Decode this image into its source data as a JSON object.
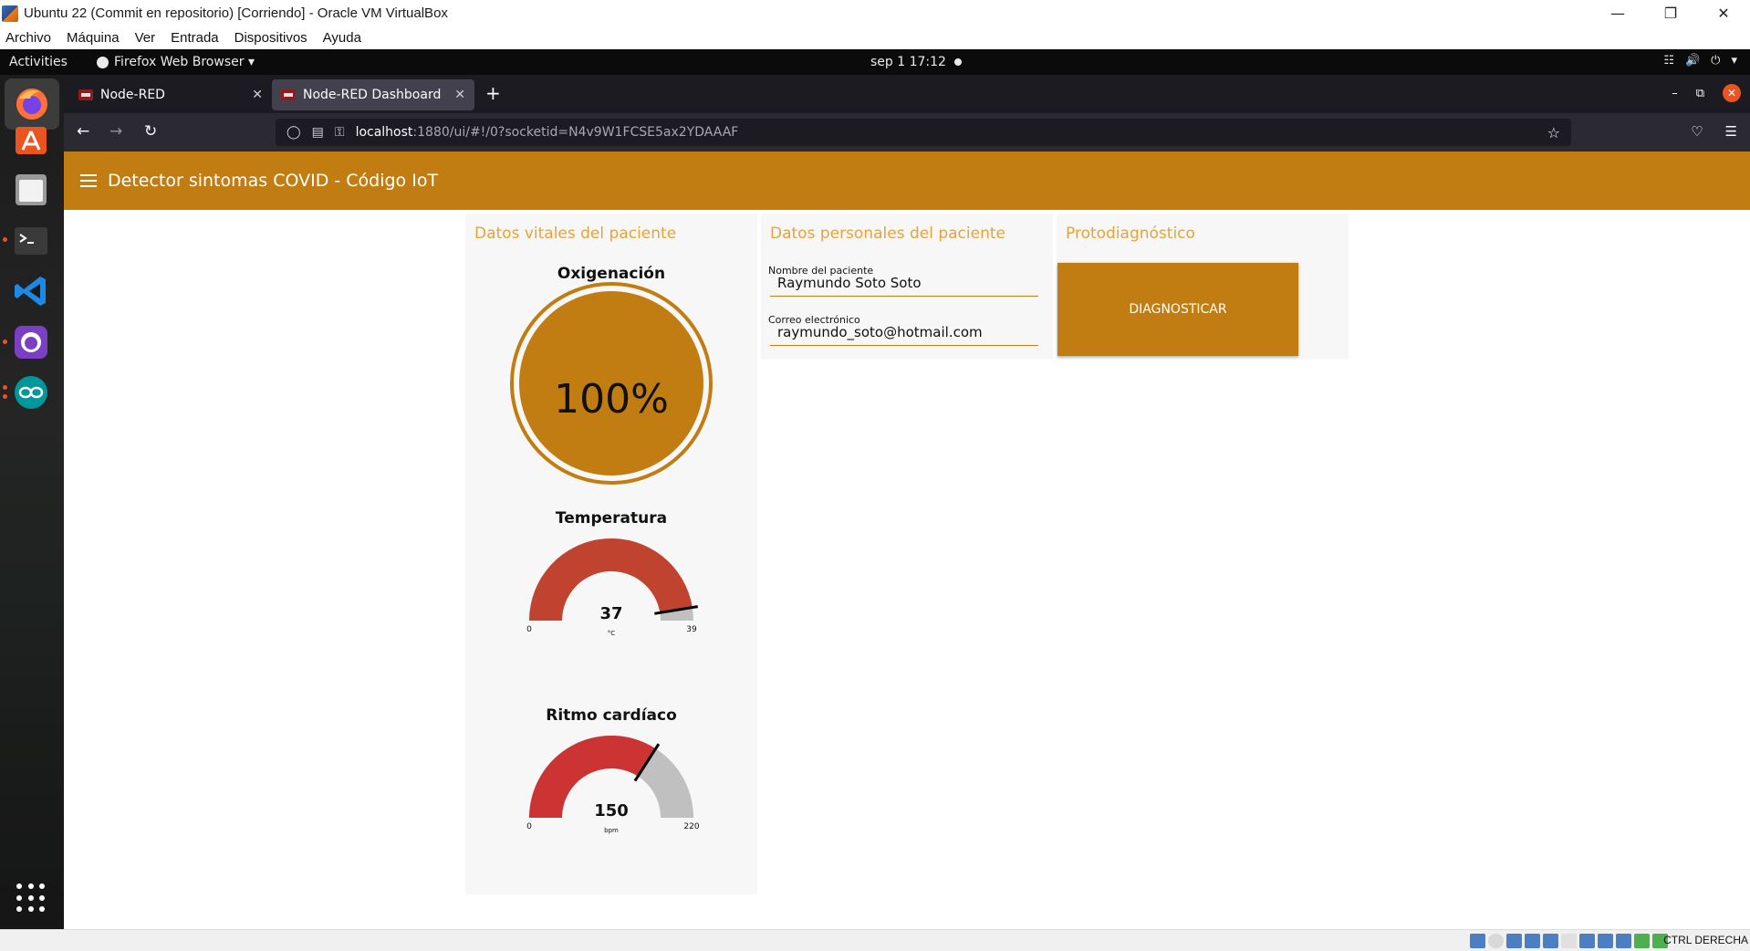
{
  "window": {
    "title": "Ubuntu 22 (Commit en repositorio) [Corriendo] - Oracle VM VirtualBox",
    "controls": {
      "minimize": "—",
      "restore": "❐",
      "close": "✕"
    },
    "menus": [
      "Archivo",
      "Máquina",
      "Ver",
      "Entrada",
      "Dispositivos",
      "Ayuda"
    ]
  },
  "gnome": {
    "activities": "Activities",
    "app_name": "Firefox Web Browser ▾",
    "clock": "sep 1  17:12"
  },
  "firefox": {
    "tabs": [
      {
        "label": "Node-RED",
        "close": "✕"
      },
      {
        "label": "Node-RED Dashboard",
        "close": "✕"
      }
    ],
    "new_tab": "+",
    "url_host": "localhost",
    "url_path": ":1880/ui/#!/0?socketid=N4v9W1FCSE5ax2YDAAAF"
  },
  "dashboard": {
    "title": "Detector sintomas COVID - Código IoT",
    "vitals": {
      "title": "Datos vitales del paciente",
      "oxygen": {
        "label": "Oxigenación",
        "value": "100%",
        "level": 100
      },
      "temperature": {
        "label": "Temperatura",
        "value": "37",
        "unit": "°C",
        "min": "0",
        "max": "39",
        "level": 37,
        "range": [
          0,
          39
        ]
      },
      "heart": {
        "label": "Ritmo cardíaco",
        "value": "150",
        "unit": "bpm",
        "min": "0",
        "max": "220",
        "level": 150,
        "range": [
          0,
          220
        ]
      }
    },
    "personal": {
      "title": "Datos personales del paciente",
      "name_label": "Nombre del paciente",
      "name_value": "Raymundo Soto Soto",
      "email_label": "Correo electrónico",
      "email_value": "raymundo_soto@hotmail.com"
    },
    "diagnosis": {
      "title": "Protodiagnóstico",
      "button": "DIAGNOSTICAR"
    }
  },
  "statusbar": {
    "host_key": "CTRL DERECHA"
  },
  "colors": {
    "accent": "#c17d11",
    "group_title": "#e5a33a",
    "temp_gauge": "#c0432f",
    "heart_gauge": "#cc3333",
    "gauge_bg": "#c0c0c0"
  }
}
